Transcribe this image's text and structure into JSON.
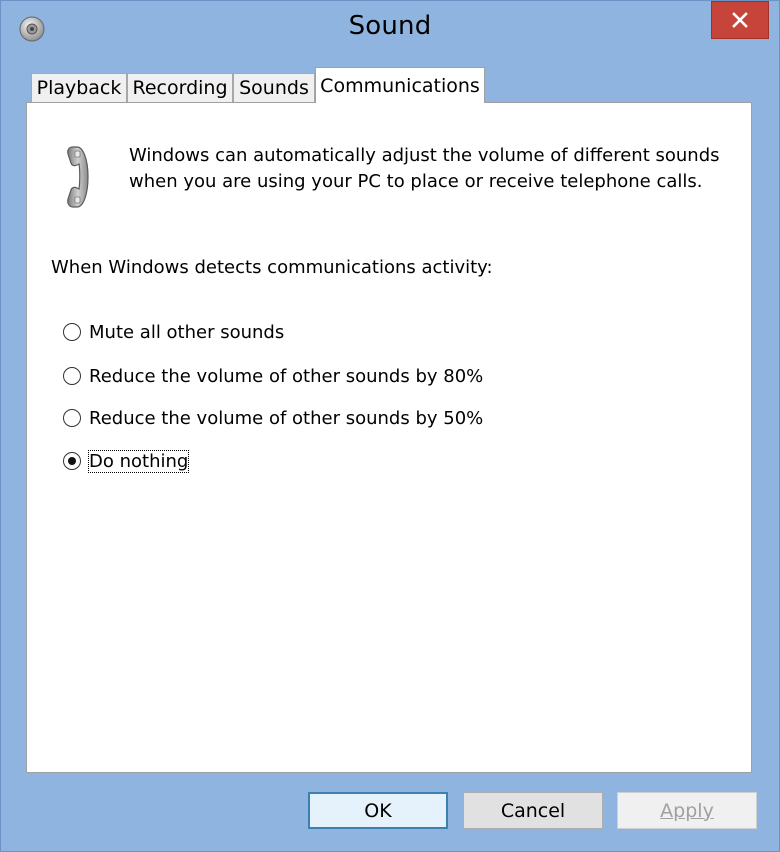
{
  "window": {
    "title": "Sound",
    "icon": "speaker-icon",
    "close_icon": "close-icon"
  },
  "tabs": [
    {
      "label": "Playback",
      "active": false
    },
    {
      "label": "Recording",
      "active": false
    },
    {
      "label": "Sounds",
      "active": false
    },
    {
      "label": "Communications",
      "active": true
    }
  ],
  "panel": {
    "icon": "telephone-icon",
    "intro_line1": "Windows can automatically adjust the volume of different sounds",
    "intro_line2": "when you are using your PC to place or receive telephone calls.",
    "group_label": "When Windows detects communications activity:",
    "options": [
      {
        "label": "Mute all other sounds",
        "checked": false
      },
      {
        "label": "Reduce the volume of other sounds by 80%",
        "checked": false
      },
      {
        "label": "Reduce the volume of other sounds by 50%",
        "checked": false
      },
      {
        "label": "Do nothing",
        "checked": true
      }
    ]
  },
  "buttons": {
    "ok": "OK",
    "cancel": "Cancel",
    "apply": "Apply",
    "apply_enabled": false
  },
  "colors": {
    "titlebar": "#8fb4e0",
    "close": "#c7443a"
  }
}
